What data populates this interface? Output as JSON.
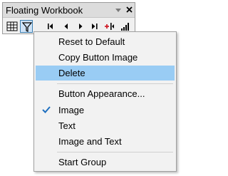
{
  "window": {
    "title": "Floating Workbook"
  },
  "toolbar": {
    "buttons": [
      {
        "icon": "sheet-grid-icon"
      },
      {
        "icon": "filter-icon"
      },
      {
        "icon": "first-record-icon"
      },
      {
        "icon": "previous-record-icon"
      },
      {
        "icon": "next-record-icon"
      },
      {
        "icon": "last-record-icon"
      },
      {
        "icon": "add-record-icon"
      },
      {
        "icon": "signal-bars-icon"
      }
    ]
  },
  "context_menu": {
    "items": [
      {
        "label": "Reset to Default"
      },
      {
        "label": "Copy Button Image"
      },
      {
        "label": "Delete",
        "highlighted": true
      },
      {
        "label": "Button Appearance..."
      },
      {
        "label": "Image",
        "checked": true
      },
      {
        "label": "Text"
      },
      {
        "label": "Image and Text"
      },
      {
        "label": "Start Group"
      }
    ]
  },
  "colors": {
    "highlight": "#99ccf4",
    "check": "#1e6fbf",
    "accent_red": "#d0202a"
  }
}
